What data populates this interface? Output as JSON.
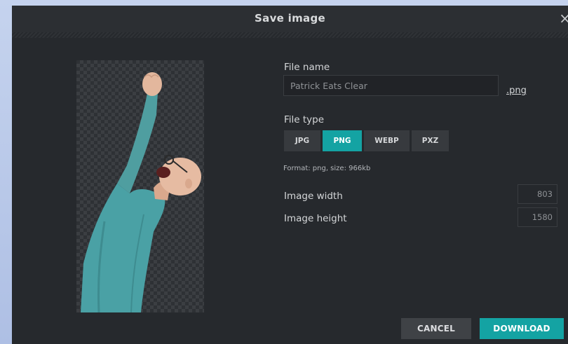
{
  "dialog": {
    "title": "Save image",
    "close_glyph": "×"
  },
  "file": {
    "name_label": "File name",
    "name_value": "Patrick Eats Clear",
    "extension": ".png",
    "type_label": "File type",
    "types": [
      "JPG",
      "PNG",
      "WEBP",
      "PXZ"
    ],
    "selected_type": "PNG",
    "format_info": "Format: png, size: 966kb"
  },
  "dimensions": {
    "width_label": "Image width",
    "width_value": "803",
    "height_label": "Image height",
    "height_value": "1580"
  },
  "actions": {
    "cancel_label": "CANCEL",
    "download_label": "DOWNLOAD"
  },
  "colors": {
    "accent": "#14a3a3",
    "dialog_bg": "#26292d"
  }
}
